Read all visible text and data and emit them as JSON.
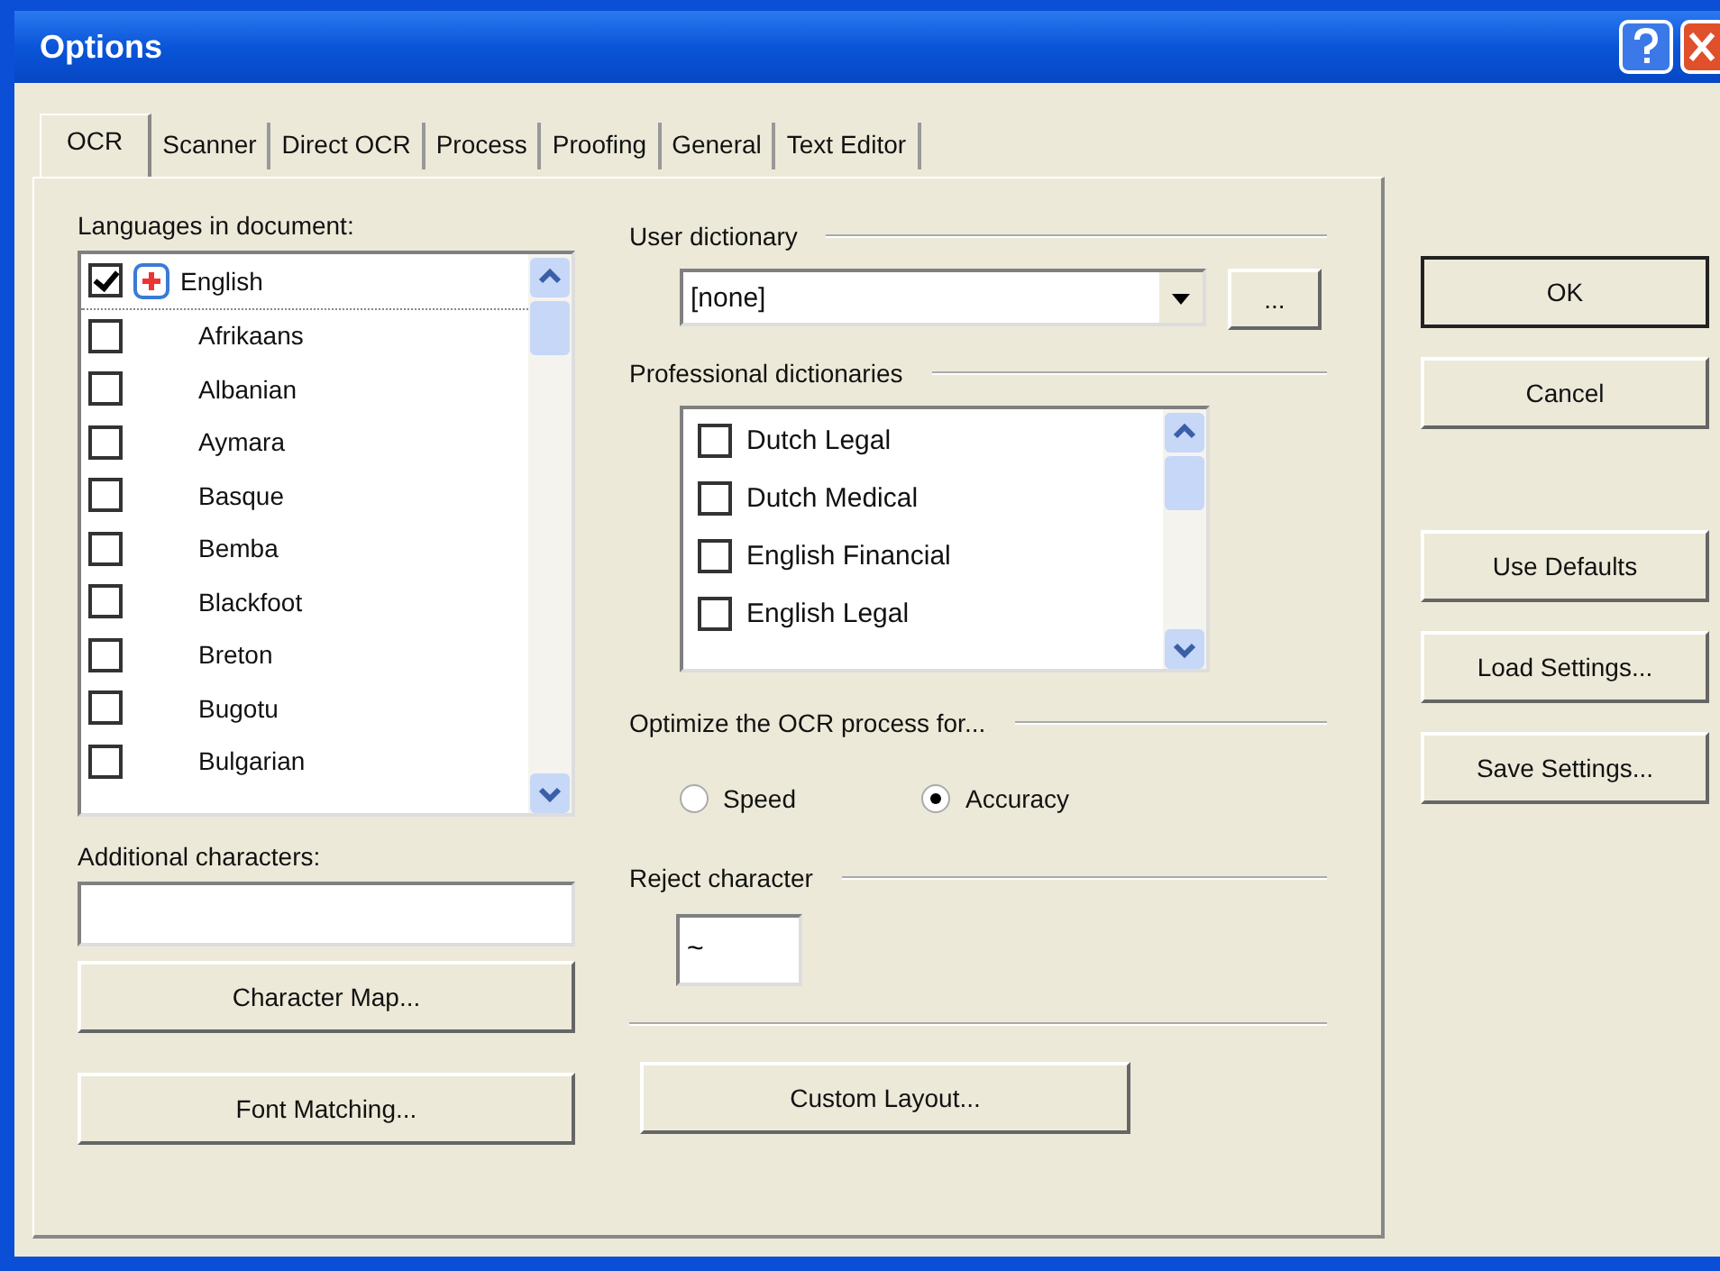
{
  "window": {
    "title": "Options"
  },
  "tabs": [
    {
      "label": "OCR",
      "selected": true
    },
    {
      "label": "Scanner",
      "selected": false
    },
    {
      "label": "Direct OCR",
      "selected": false
    },
    {
      "label": "Process",
      "selected": false
    },
    {
      "label": "Proofing",
      "selected": false
    },
    {
      "label": "General",
      "selected": false
    },
    {
      "label": "Text Editor",
      "selected": false
    }
  ],
  "languages": {
    "label": "Languages in document:",
    "items": [
      {
        "name": "English",
        "checked": true,
        "selected": true
      },
      {
        "name": "Afrikaans",
        "checked": false,
        "selected": false
      },
      {
        "name": "Albanian",
        "checked": false,
        "selected": false
      },
      {
        "name": "Aymara",
        "checked": false,
        "selected": false
      },
      {
        "name": "Basque",
        "checked": false,
        "selected": false
      },
      {
        "name": "Bemba",
        "checked": false,
        "selected": false
      },
      {
        "name": "Blackfoot",
        "checked": false,
        "selected": false
      },
      {
        "name": "Breton",
        "checked": false,
        "selected": false
      },
      {
        "name": "Bugotu",
        "checked": false,
        "selected": false
      },
      {
        "name": "Bulgarian",
        "checked": false,
        "selected": false
      }
    ]
  },
  "additional_characters": {
    "label": "Additional characters:"
  },
  "character_map_button": "Character Map...",
  "font_matching_button": "Font Matching...",
  "user_dictionary": {
    "label": "User dictionary",
    "value": "[none]",
    "browse_button": "..."
  },
  "professional_dictionaries": {
    "label": "Professional dictionaries",
    "items": [
      {
        "name": "Dutch Legal",
        "checked": false
      },
      {
        "name": "Dutch Medical",
        "checked": false
      },
      {
        "name": "English Financial",
        "checked": false
      },
      {
        "name": "English Legal",
        "checked": false
      }
    ]
  },
  "optimize": {
    "label": "Optimize the OCR process for...",
    "options": [
      {
        "label": "Speed",
        "selected": false
      },
      {
        "label": "Accuracy",
        "selected": true
      }
    ]
  },
  "reject_character": {
    "label": "Reject character",
    "value": "~"
  },
  "custom_layout_button": "Custom Layout...",
  "buttons": [
    {
      "label": "OK",
      "default": true
    },
    {
      "label": "Cancel",
      "default": false
    },
    {
      "label": "Use Defaults",
      "default": false
    },
    {
      "label": "Load Settings...",
      "default": false
    },
    {
      "label": "Save Settings...",
      "default": false
    }
  ]
}
